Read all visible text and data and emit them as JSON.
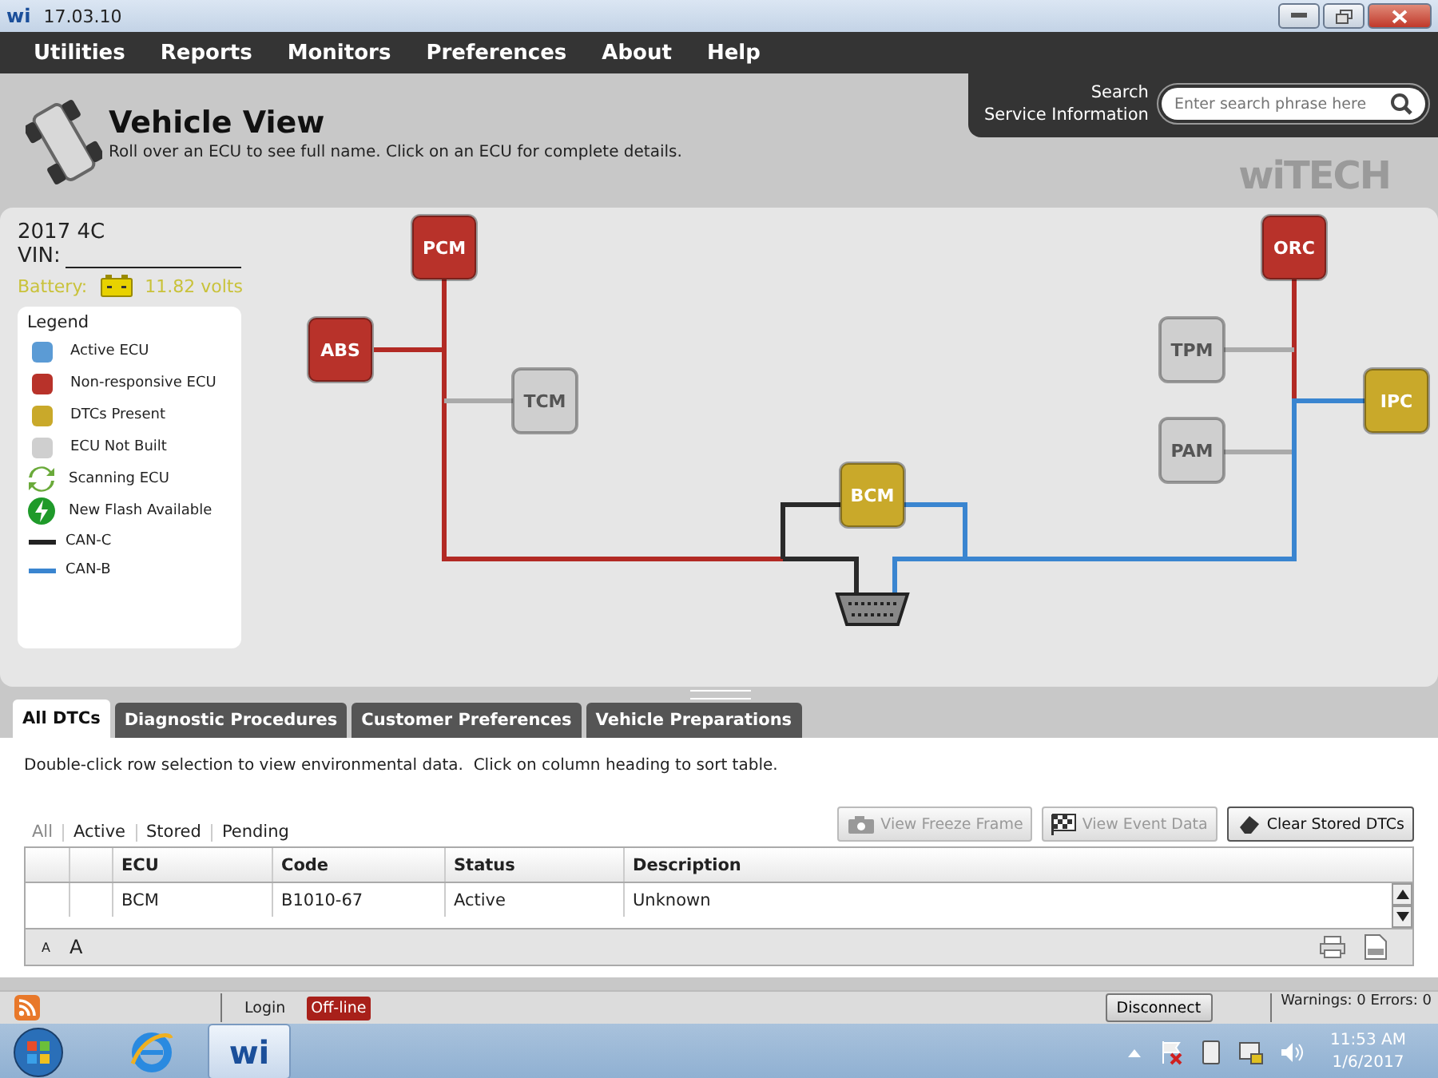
{
  "window": {
    "logo": "wi",
    "title": "17.03.10"
  },
  "menu": [
    "Utilities",
    "Reports",
    "Monitors",
    "Preferences",
    "About",
    "Help"
  ],
  "search": {
    "label_1": "Search",
    "label_2": "Service Information",
    "placeholder": "Enter search phrase here"
  },
  "header": {
    "title": "Vehicle View",
    "subtitle": "Roll over an ECU to see full name. Click on an ECU for complete details.",
    "logo": "wiTECH"
  },
  "vehicle": {
    "model": "2017 4C",
    "vin_label": "VIN:",
    "battery_label": "Battery:",
    "battery_reading": "11.82 volts"
  },
  "legend": {
    "title": "Legend",
    "items": [
      {
        "kind": "swatch",
        "label": "Active ECU",
        "color": "#5b9bd5"
      },
      {
        "kind": "swatch",
        "label": "Non-responsive ECU",
        "color": "#b8322a"
      },
      {
        "kind": "swatch",
        "label": "DTCs Present",
        "color": "#c9a92a"
      },
      {
        "kind": "swatch",
        "label": "ECU Not Built",
        "color": "#cfcfcf"
      },
      {
        "kind": "scanning",
        "label": "Scanning ECU"
      },
      {
        "kind": "flash",
        "label": "New Flash Available"
      },
      {
        "kind": "line",
        "label": "CAN-C",
        "color": "#222222"
      },
      {
        "kind": "line",
        "label": "CAN-B",
        "color": "#3a85d0"
      }
    ]
  },
  "ecus": [
    {
      "label": "PCM",
      "color": "#b8322a"
    },
    {
      "label": "ABS",
      "color": "#b8322a"
    },
    {
      "label": "TCM",
      "color": "#cfcfcf"
    },
    {
      "label": "BCM",
      "color": "#c9a92a"
    },
    {
      "label": "ORC",
      "color": "#b8322a"
    },
    {
      "label": "TPM",
      "color": "#cfcfcf"
    },
    {
      "label": "IPC",
      "color": "#c9a92a"
    },
    {
      "label": "PAM",
      "color": "#cfcfcf"
    }
  ],
  "tabs": [
    {
      "label": "All DTCs",
      "selected": true
    },
    {
      "label": "Diagnostic Procedures",
      "selected": false
    },
    {
      "label": "Customer Preferences",
      "selected": false
    },
    {
      "label": "Vehicle Preparations",
      "selected": false
    }
  ],
  "instructions": "Double-click row selection to view environmental data.  Click on column heading to sort table.",
  "filters": [
    {
      "label": "All",
      "selected": true
    },
    {
      "label": "Active",
      "selected": false
    },
    {
      "label": "Stored",
      "selected": false
    },
    {
      "label": "Pending",
      "selected": false
    }
  ],
  "actions": [
    {
      "label": "View Freeze Frame",
      "kind": "camera",
      "disabled": true
    },
    {
      "label": "View Event Data",
      "kind": "flag",
      "disabled": true
    },
    {
      "label": "Clear Stored DTCs",
      "kind": "eraser",
      "disabled": false
    }
  ],
  "table": {
    "columns": [
      "",
      "",
      "ECU",
      "Code",
      "Status",
      "Description"
    ],
    "rows": [
      [
        "",
        "",
        "BCM",
        "B1010-67",
        "Active",
        "Unknown"
      ]
    ]
  },
  "font_sizes": [
    "A",
    "A"
  ],
  "status_bar": {
    "login": "Login",
    "connection": "Off-line",
    "disconnect": "Disconnect",
    "counts": "Warnings: 0 Errors: 0"
  },
  "taskbar": {
    "app": "wi",
    "time": "11:53 AM",
    "date": "1/6/2017"
  }
}
